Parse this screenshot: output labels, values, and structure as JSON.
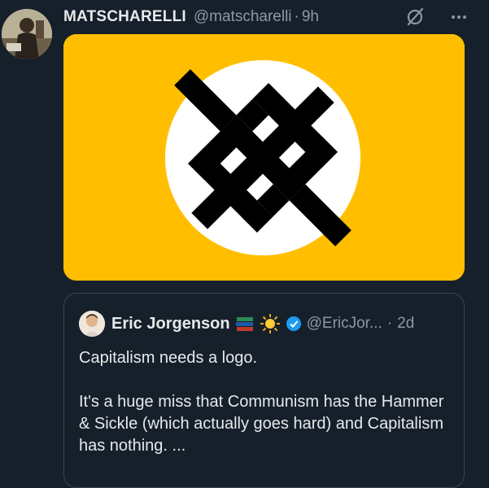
{
  "tweet": {
    "author_name": "MATSCHARELLI",
    "author_handle": "@matscharelli",
    "separator": "·",
    "time": "9h",
    "icons": {
      "avatar": "avatar-illustration",
      "grok": "grok-icon",
      "more": "more-icon"
    }
  },
  "media": {
    "background": "#ffbf00",
    "circle": "#ffffff",
    "symbol": "#000000"
  },
  "quote": {
    "author_name": "Eric Jorgenson",
    "author_handle": "@EricJor...",
    "separator": "·",
    "time": "2d",
    "badges": [
      "books-emoji",
      "sun-emoji",
      "verified-icon"
    ],
    "text": "Capitalism needs a logo.\n\nIt's a huge miss that Communism has the Hammer & Sickle (which actually goes hard) and Capitalism has nothing. ..."
  }
}
